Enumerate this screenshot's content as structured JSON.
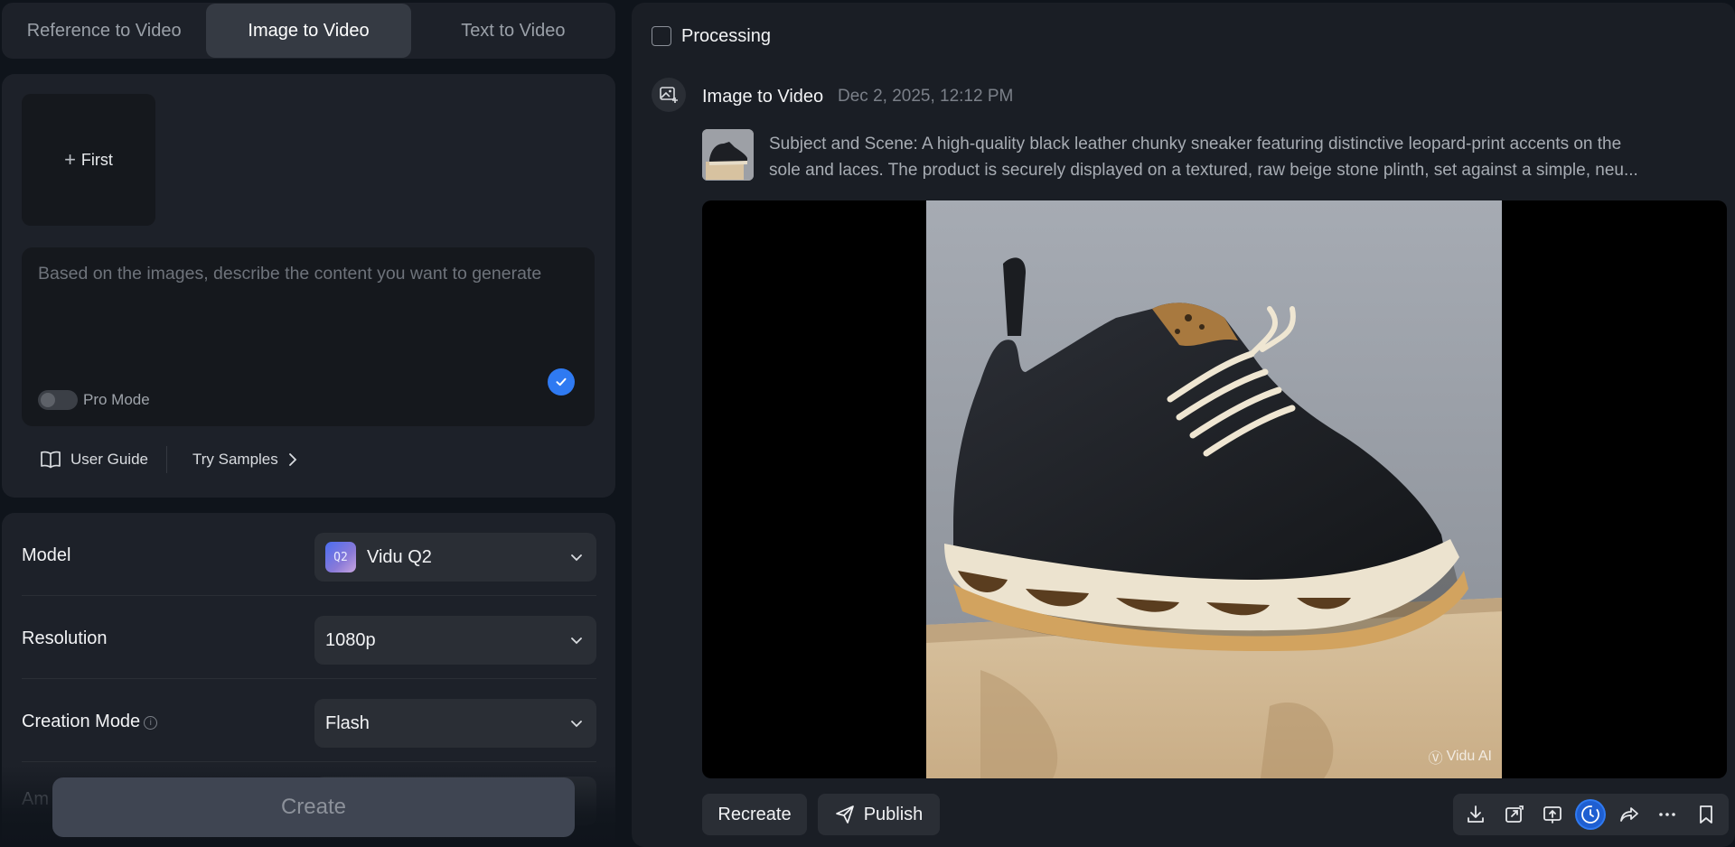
{
  "tabs": [
    {
      "label": "Reference to Video",
      "active": false
    },
    {
      "label": "Image to Video",
      "active": true
    },
    {
      "label": "Text to Video",
      "active": false
    }
  ],
  "upload": {
    "first_label": "First"
  },
  "prompt": {
    "placeholder": "Based on the images, describe the content you want to generate",
    "pro_mode_label": "Pro Mode",
    "pro_mode_on": false
  },
  "links": {
    "user_guide": "User Guide",
    "try_samples": "Try Samples"
  },
  "settings": {
    "model": {
      "label": "Model",
      "value": "Vidu Q2",
      "badge": "Q2"
    },
    "resolution": {
      "label": "Resolution",
      "value": "1080p"
    },
    "creation_mode": {
      "label": "Creation Mode",
      "value": "Flash"
    },
    "amount": {
      "label": "Am"
    }
  },
  "create_label": "Create",
  "task": {
    "processing_label": "Processing",
    "type": "Image to Video",
    "date": "Dec 2, 2025, 12:12 PM",
    "description_line1": "Subject and Scene: A high-quality black leather chunky sneaker featuring distinctive leopard-print accents on the",
    "description_line2": "sole and laces. The product is securely displayed on a textured, raw beige stone plinth, set against a simple, neu...",
    "watermark": "Vidu AI"
  },
  "actions": {
    "recreate": "Recreate",
    "publish": "Publish"
  },
  "toolbar_icons": [
    "download-icon",
    "extend-icon",
    "upscale-icon",
    "history-icon",
    "share-icon",
    "more-icon",
    "bookmark-icon"
  ],
  "colors": {
    "accent": "#2f7af2",
    "panel": "#1d2129",
    "background": "#0f141b"
  }
}
